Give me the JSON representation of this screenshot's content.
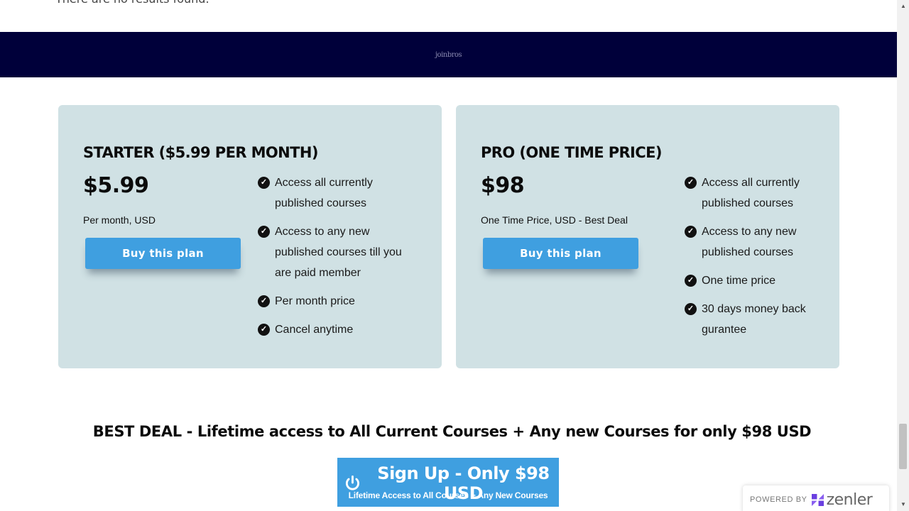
{
  "top_text": "There are no results found.",
  "banner": {
    "logo_text": "joinbros"
  },
  "plans": [
    {
      "title": "STARTER ($5.99 PER MONTH)",
      "price": "$5.99",
      "subtitle": "Per month, USD",
      "button_label": "Buy this plan",
      "features": [
        "Access all currently published courses",
        "Access to any new published courses till you are paid member",
        "Per month price",
        "Cancel anytime"
      ]
    },
    {
      "title": "PRO (ONE TIME PRICE)",
      "price": "$98",
      "subtitle": "One Time Price, USD - Best Deal",
      "button_label": "Buy this plan",
      "features": [
        "Access all currently published courses",
        "Access to any new published courses",
        "One time price",
        "30 days money back gurantee"
      ]
    }
  ],
  "best_deal": "BEST DEAL - Lifetime access to All Current Courses + Any new Courses for only $98 USD",
  "signup": {
    "title": "Sign Up - Only $98 USD",
    "subtitle": "Lifetime Access to All Courses + Any New Courses"
  },
  "powered_by": {
    "label": "POWERED BY",
    "brand": "zenler"
  },
  "colors": {
    "banner_bg": "#00003a",
    "card_bg": "#d0e1e4",
    "button_blue": "#3f9fe0",
    "zenler_purple": "#6a3fe0"
  }
}
